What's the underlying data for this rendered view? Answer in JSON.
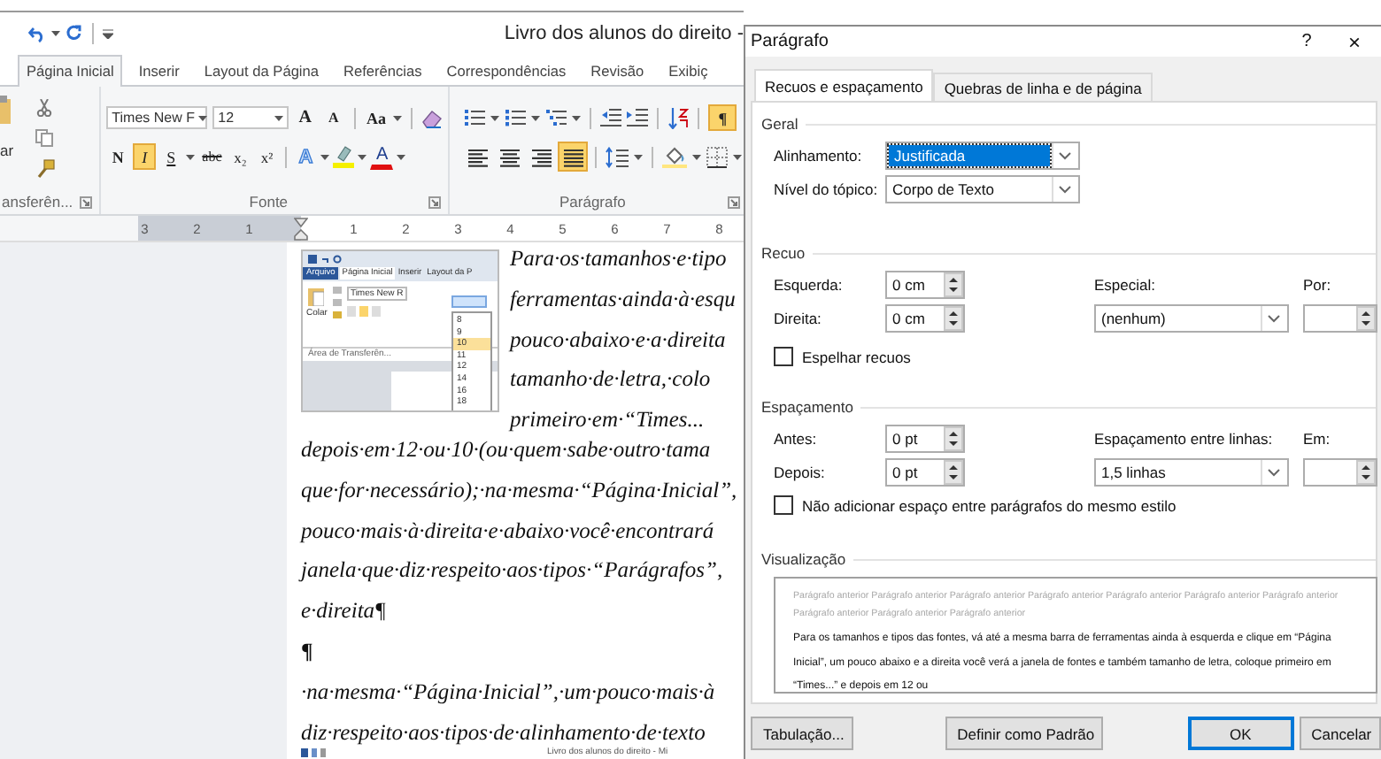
{
  "word": {
    "title": "Livro dos alunos do direito -",
    "tabs": [
      {
        "label": "Página Inicial",
        "selected": true
      },
      {
        "label": "Inserir",
        "selected": false
      },
      {
        "label": "Layout da Página",
        "selected": false
      },
      {
        "label": "Referências",
        "selected": false
      },
      {
        "label": "Correspondências",
        "selected": false
      },
      {
        "label": "Revisão",
        "selected": false
      },
      {
        "label": "Exibiç",
        "selected": false
      }
    ],
    "clipboard": {
      "paste_fragment": "ar",
      "group_label": "ansferên..."
    },
    "font_group": {
      "font_name": "Times New F",
      "font_size": "12",
      "grow_label": "A",
      "shrink_label": "A",
      "case_label": "Aa",
      "effects_label": "A",
      "font_color_label": "A",
      "group_label": "Fonte",
      "format_buttons": [
        {
          "kind": "bold",
          "label": "N",
          "on": false
        },
        {
          "kind": "italic",
          "label": "I",
          "on": true
        },
        {
          "kind": "underline",
          "label": "S",
          "on": false
        },
        {
          "kind": "strikethrough",
          "label": "abc",
          "on": false
        },
        {
          "kind": "subscript",
          "label": "x₂",
          "on": false
        },
        {
          "kind": "superscript",
          "label": "x²",
          "on": false
        }
      ]
    },
    "paragraph_group": {
      "show_marks_label": "¶",
      "show_marks_on": true,
      "group_label": "Parágrafo",
      "alignments": [
        {
          "kind": "left",
          "selected": false
        },
        {
          "kind": "center",
          "selected": false
        },
        {
          "kind": "right",
          "selected": false
        },
        {
          "kind": "justify",
          "selected": true
        }
      ]
    },
    "ruler": [
      "3",
      "2",
      "1",
      "1",
      "2",
      "3",
      "4",
      "5",
      "6",
      "7",
      "8"
    ],
    "document": {
      "inset": {
        "file_tab": "Arquivo",
        "tabs": [
          {
            "label": "Página Inicial",
            "selected": true
          },
          {
            "label": "Inserir",
            "selected": false
          },
          {
            "label": "Layout da P",
            "selected": false
          }
        ],
        "paste_label": "Colar",
        "font_name": "Times New R",
        "group_label": "Área de Transferên...",
        "size_options": [
          {
            "label": "8",
            "selected": false
          },
          {
            "label": "9",
            "selected": false
          },
          {
            "label": "10",
            "selected": true
          },
          {
            "label": "11",
            "selected": false
          },
          {
            "label": "12",
            "selected": false
          },
          {
            "label": "14",
            "selected": false
          },
          {
            "label": "16",
            "selected": false
          },
          {
            "label": "18",
            "selected": false
          }
        ]
      },
      "wrapped_lines": [
        "Para·os·tamanhos·e·tipo",
        "ferramentas·ainda·à·esqu",
        "pouco·abaixo·e·a·direita",
        "tamanho·de·letra,·colo",
        "primeiro·em·“Times..."
      ],
      "lines": [
        {
          "kind": "text",
          "text": "depois·em·12·ou·10·(ou·quem·sabe·outro·tama"
        },
        {
          "kind": "text",
          "text": "que·for·necessário);·na·mesma·“Página·Inicial”,"
        },
        {
          "kind": "text",
          "text": "pouco·mais·à·direita·e·abaixo·você·encontrará"
        },
        {
          "kind": "text",
          "text": "janela·que·diz·respeito·aos·tipos·“Parágrafos”,"
        },
        {
          "kind": "text",
          "text": "e·direita¶"
        },
        {
          "kind": "mark",
          "text": "¶"
        },
        {
          "kind": "text",
          "text": "·na·mesma·“Página·Inicial”,·um·pouco·mais·à"
        },
        {
          "kind": "text",
          "text": "diz·respeito·aos·tipos·de·alinhamento·de·texto"
        }
      ],
      "caption": "Livro dos alunos do direito - Mi"
    }
  },
  "dialog": {
    "title": "Parágrafo",
    "help": "?",
    "close": "×",
    "tabs": [
      {
        "label": "Recuos e espaçamento",
        "selected": true
      },
      {
        "label": "Quebras de linha e de página",
        "selected": false
      }
    ],
    "general": {
      "title": "Geral",
      "alignment": {
        "label": "Alinhamento:",
        "value": "Justificada",
        "focused": true
      },
      "outline_level": {
        "label": "Nível do tópico:",
        "value": "Corpo de Texto"
      }
    },
    "indent": {
      "title": "Recuo",
      "left": {
        "label": "Esquerda:",
        "value": "0 cm"
      },
      "right": {
        "label": "Direita:",
        "value": "0 cm"
      },
      "special": {
        "label": "Especial:",
        "value": "(nenhum)"
      },
      "by": {
        "label": "Por:"
      },
      "mirror": {
        "label": "Espelhar recuos",
        "checked": false
      }
    },
    "spacing": {
      "title": "Espaçamento",
      "before": {
        "label": "Antes:",
        "value": "0 pt"
      },
      "after": {
        "label": "Depois:",
        "value": "0 pt"
      },
      "line_spacing": {
        "label": "Espaçamento entre linhas:",
        "value": "1,5 linhas"
      },
      "at": {
        "label": "Em:"
      },
      "dont_add": {
        "label": "Não adicionar espaço entre parágrafos do mesmo estilo",
        "checked": false
      }
    },
    "preview": {
      "title": "Visualização",
      "previous_text": "Parágrafo anterior Parágrafo anterior Parágrafo anterior Parágrafo anterior Parágrafo anterior Parágrafo anterior Parágrafo anterior Parágrafo anterior Parágrafo anterior Parágrafo anterior",
      "sample_text": "Para os tamanhos e tipos das fontes, vá até a mesma barra de ferramentas ainda à esquerda e clique em “Página Inicial”, um pouco abaixo e a direita você verá a janela de fontes e também tamanho de letra, coloque primeiro em “Times...” e depois em 12 ou"
    },
    "buttons": [
      {
        "label": "Tabulação...",
        "default": false
      },
      {
        "label": "Definir como Padrão",
        "default": false
      },
      {
        "label": "OK",
        "default": true
      },
      {
        "label": "Cancelar",
        "default": false
      }
    ]
  }
}
